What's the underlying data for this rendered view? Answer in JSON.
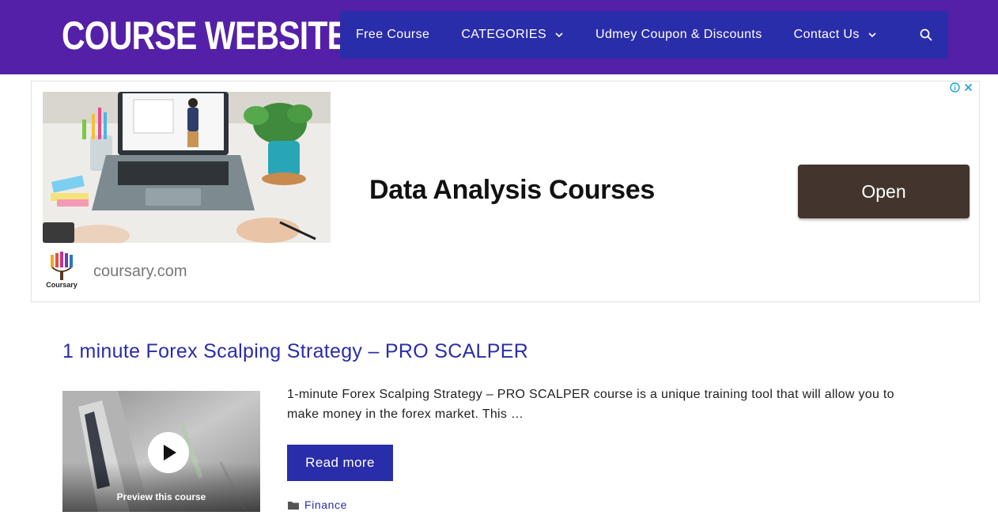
{
  "header": {
    "site_title": "COURSE WEBSITE",
    "nav": [
      {
        "label": "Free Course",
        "has_dropdown": false
      },
      {
        "label": "CATEGORIES",
        "has_dropdown": true
      },
      {
        "label": "Udmey Coupon & Discounts",
        "has_dropdown": false
      },
      {
        "label": "Contact Us",
        "has_dropdown": true
      }
    ],
    "search_icon": "search-icon"
  },
  "ad": {
    "headline": "Data Analysis Courses",
    "button_label": "Open",
    "logo_text": "Coursary",
    "domain": "coursary.com",
    "icons": [
      "info-icon",
      "close-icon"
    ]
  },
  "post": {
    "title": "1 minute Forex Scalping Strategy – PRO SCALPER",
    "thumbnail_caption": "Preview this course",
    "excerpt": "1-minute Forex Scalping Strategy – PRO SCALPER course is a unique training tool that will allow you to make money in the forex market. This …",
    "read_more_label": "Read more",
    "category": "Finance"
  },
  "colors": {
    "header_bg": "#5420a8",
    "nav_bg": "#2a2da9",
    "link": "#2a2da9",
    "ad_button": "#43352e"
  }
}
